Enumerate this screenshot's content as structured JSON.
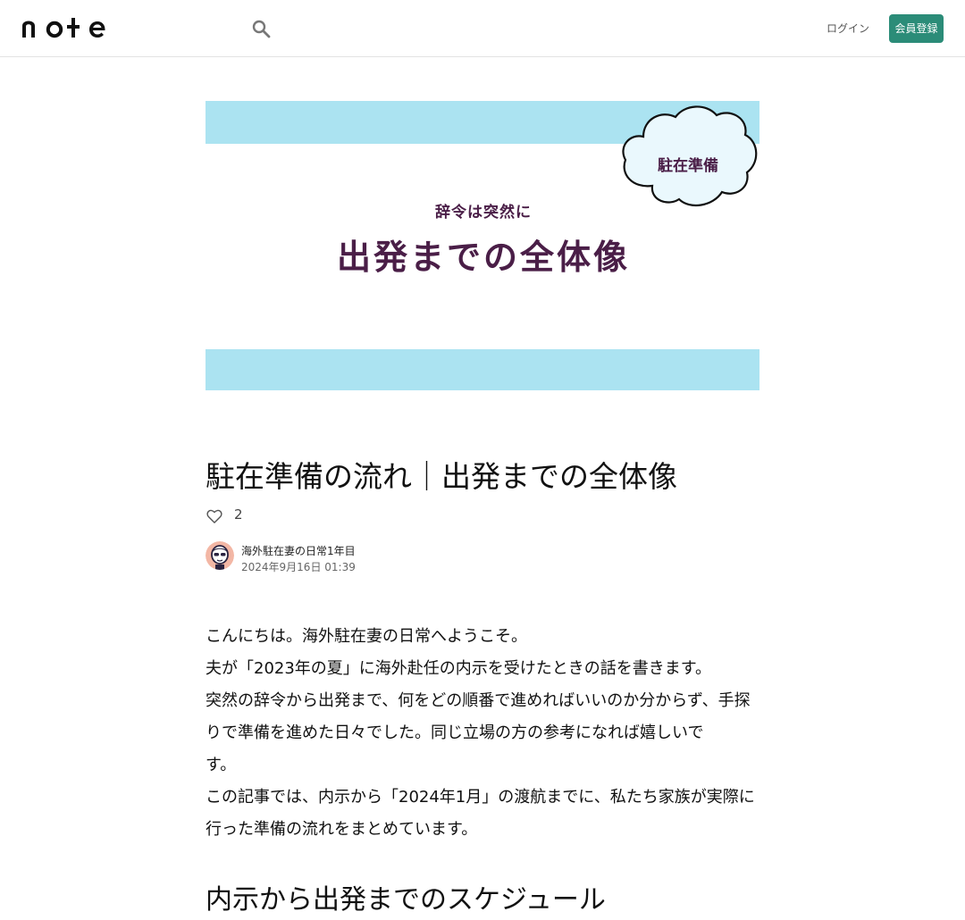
{
  "header": {
    "logo_text": "note",
    "search_icon": "search-icon",
    "login_label": "ログイン",
    "signup_label": "会員登録"
  },
  "hero": {
    "kicker": "辞令は突然に",
    "title": "出発までの全体像",
    "badge": "駐在準備"
  },
  "article": {
    "title": "駐在準備の流れ｜出発までの全体像",
    "like_count": "2",
    "author_name": "海外駐在妻の日常1年目",
    "date": "2024年9月16日 01:39",
    "paragraphs": [
      "こんにちは。海外駐在妻の日常へようこそ。",
      "夫が「2023年の夏」に海外赴任の内示を受けたときの話を書きます。",
      "突然の辞令から出発まで、何をどの順番で進めればいいのか分からず、手探りで準備を進めた日々でした。同じ立場の方の参考になれば嬉しいで",
      "す。",
      "この記事では、内示から「2024年1月」の渡航までに、私たち家族が実際に行った準備の流れをまとめています。"
    ],
    "section_heading": "内示から出発までのスケジュール"
  },
  "colors": {
    "accent": "#2b8c78",
    "banner_blue": "#abe3f1",
    "banner_text": "#4a1e47"
  }
}
